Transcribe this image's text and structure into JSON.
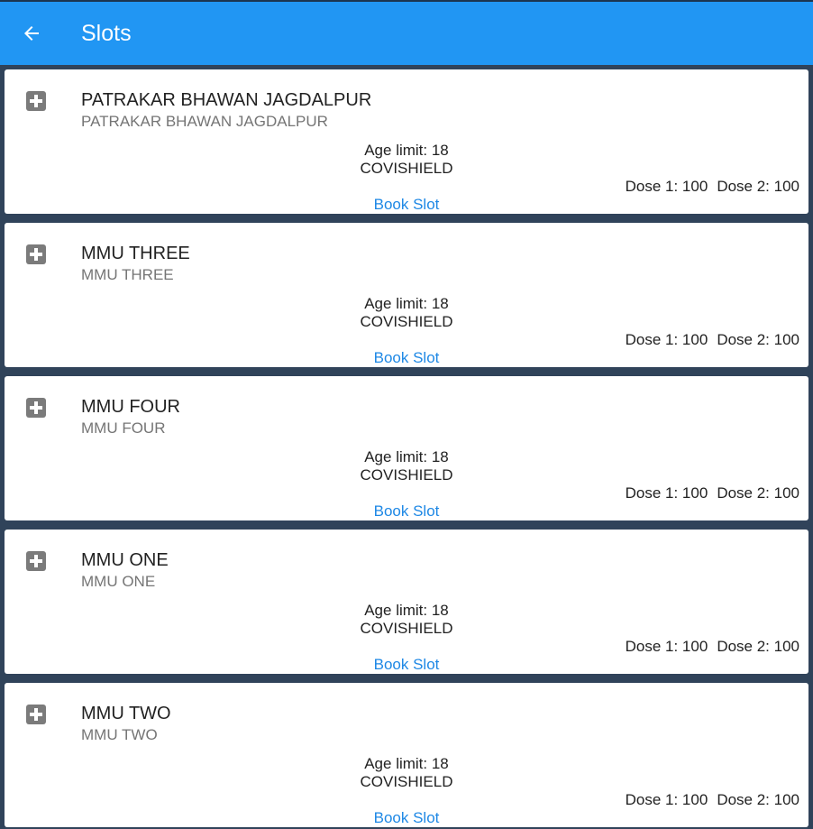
{
  "header": {
    "title": "Slots",
    "back_icon": "arrow-left-icon"
  },
  "colors": {
    "appbar": "#2196f3",
    "background": "#30435a",
    "link": "#1e88e5"
  },
  "slots": [
    {
      "name": "PATRAKAR BHAWAN JAGDALPUR",
      "address": "PATRAKAR BHAWAN JAGDALPUR",
      "age_limit": "Age limit: 18",
      "vaccine": "COVISHIELD",
      "dose1": "Dose 1: 100",
      "dose2": "Dose 2: 100",
      "book_label": "Book Slot",
      "icon": "medical-cross-icon"
    },
    {
      "name": "MMU THREE",
      "address": "MMU THREE",
      "age_limit": "Age limit: 18",
      "vaccine": "COVISHIELD",
      "dose1": "Dose 1: 100",
      "dose2": "Dose 2: 100",
      "book_label": "Book Slot",
      "icon": "medical-cross-icon"
    },
    {
      "name": "MMU FOUR",
      "address": "MMU FOUR",
      "age_limit": "Age limit: 18",
      "vaccine": "COVISHIELD",
      "dose1": "Dose 1: 100",
      "dose2": "Dose 2: 100",
      "book_label": "Book Slot",
      "icon": "medical-cross-icon"
    },
    {
      "name": "MMU ONE",
      "address": "MMU ONE",
      "age_limit": "Age limit: 18",
      "vaccine": "COVISHIELD",
      "dose1": "Dose 1: 100",
      "dose2": "Dose 2: 100",
      "book_label": "Book Slot",
      "icon": "medical-cross-icon"
    },
    {
      "name": "MMU TWO",
      "address": "MMU TWO",
      "age_limit": "Age limit: 18",
      "vaccine": "COVISHIELD",
      "dose1": "Dose 1: 100",
      "dose2": "Dose 2: 100",
      "book_label": "Book Slot",
      "icon": "medical-cross-icon"
    }
  ]
}
